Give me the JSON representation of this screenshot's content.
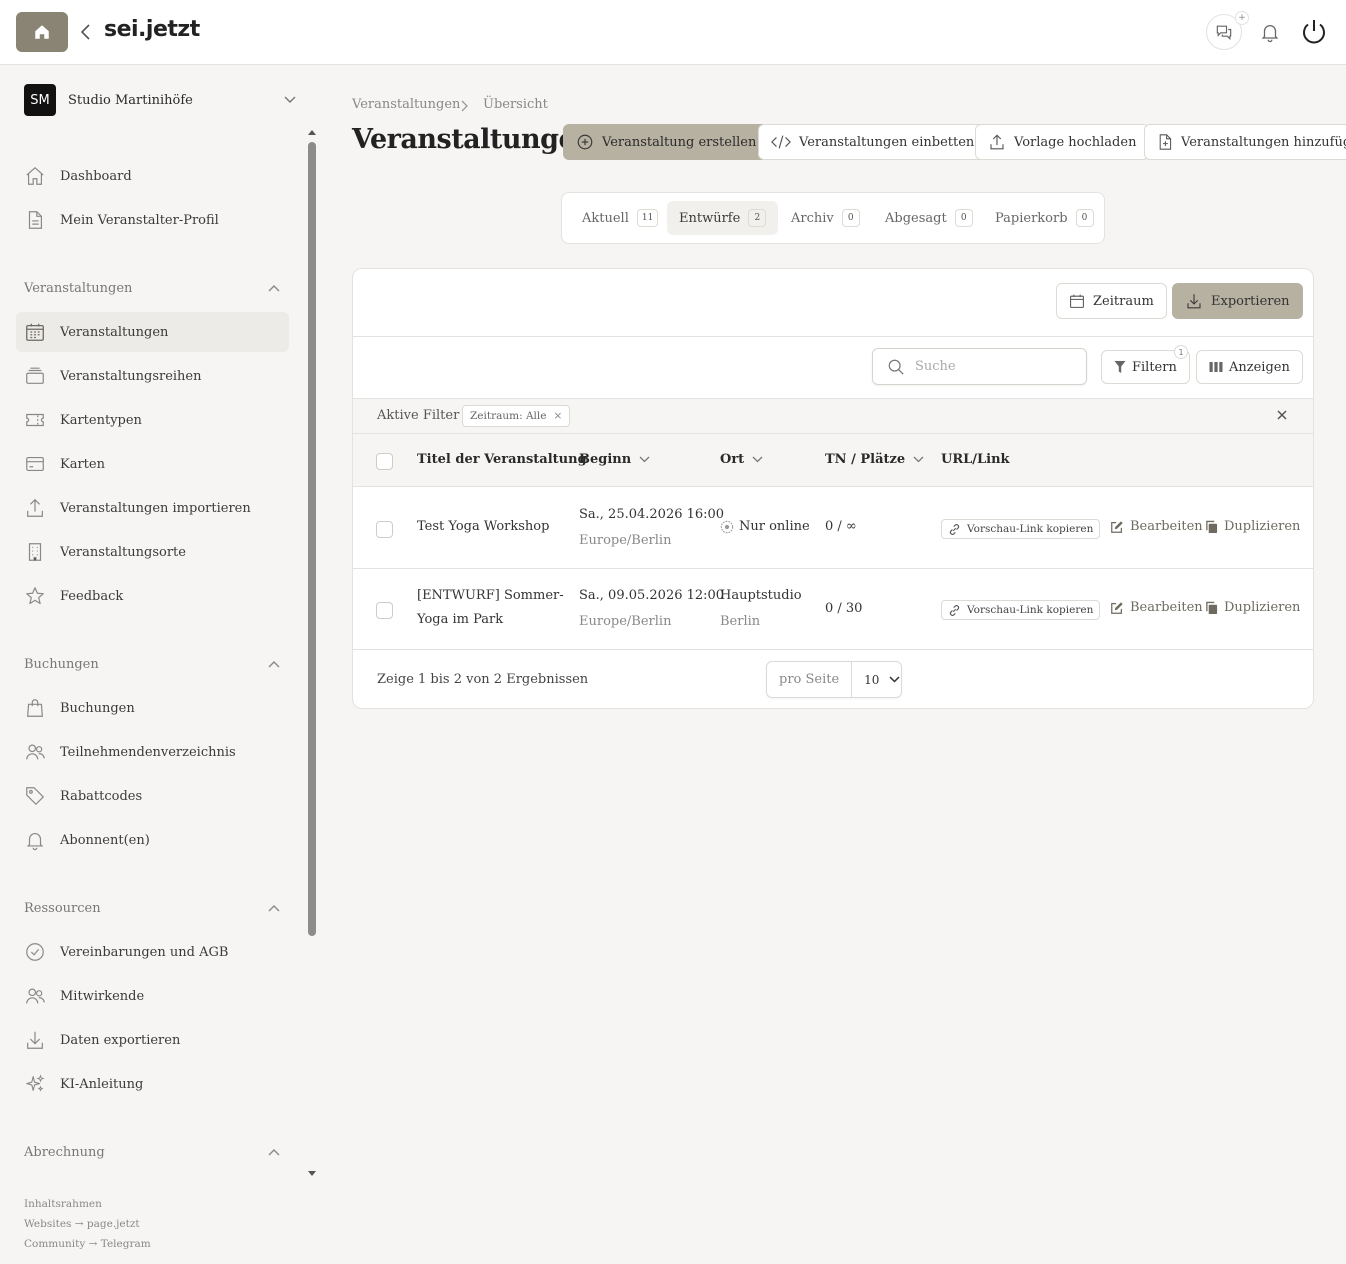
{
  "topbar": {
    "brand": "sei.jetzt",
    "chat_badge": "+"
  },
  "org": {
    "initials": "SM",
    "name": "Studio Martinihöfe"
  },
  "sidebar": {
    "top_items": [
      {
        "label": "Dashboard",
        "icon": "home-icon"
      },
      {
        "label": "Mein Veranstalter-Profil",
        "icon": "document-icon"
      }
    ],
    "sections": [
      {
        "title": "Veranstaltungen",
        "items": [
          {
            "label": "Veranstaltungen",
            "icon": "calendar-icon",
            "active": true
          },
          {
            "label": "Veranstaltungsreihen",
            "icon": "stack-icon"
          },
          {
            "label": "Kartentypen",
            "icon": "ticket-icon"
          },
          {
            "label": "Karten",
            "icon": "card-icon"
          },
          {
            "label": "Veranstaltungen importieren",
            "icon": "upload-icon"
          },
          {
            "label": "Veranstaltungsorte",
            "icon": "building-icon"
          },
          {
            "label": "Feedback",
            "icon": "star-icon"
          }
        ]
      },
      {
        "title": "Buchungen",
        "items": [
          {
            "label": "Buchungen",
            "icon": "bag-icon"
          },
          {
            "label": "Teilnehmendenverzeichnis",
            "icon": "users-icon"
          },
          {
            "label": "Rabattcodes",
            "icon": "tag-icon"
          },
          {
            "label": "Abonnent(en)",
            "icon": "bell-icon"
          }
        ]
      },
      {
        "title": "Ressourcen",
        "items": [
          {
            "label": "Vereinbarungen und AGB",
            "icon": "check-circle-icon"
          },
          {
            "label": "Mitwirkende",
            "icon": "users-icon"
          },
          {
            "label": "Daten exportieren",
            "icon": "download-icon"
          },
          {
            "label": "KI-Anleitung",
            "icon": "sparkle-icon"
          }
        ]
      },
      {
        "title": "Abrechnung",
        "items": []
      }
    ],
    "footer_links": [
      "Inhaltsrahmen",
      "Websites → page.jetzt",
      "Community → Telegram"
    ]
  },
  "breadcrumb": [
    "Veranstaltungen",
    "Übersicht"
  ],
  "page_title": "Veranstaltungen",
  "header_buttons": {
    "create": "Veranstaltung erstellen",
    "embed": "Veranstaltungen einbetten",
    "upload": "Vorlage hochladen",
    "add": "Veranstaltungen hinzufügen"
  },
  "tabs": [
    {
      "label": "Aktuell",
      "count": "11"
    },
    {
      "label": "Entwürfe",
      "count": "2",
      "active": true
    },
    {
      "label": "Archiv",
      "count": "0"
    },
    {
      "label": "Abgesagt",
      "count": "0"
    },
    {
      "label": "Papierkorb",
      "count": "0"
    }
  ],
  "toolbar": {
    "period": "Zeitraum",
    "export": "Exportieren",
    "search_placeholder": "Suche",
    "filter": "Filtern",
    "filter_count": "1",
    "display": "Anzeigen"
  },
  "active_filters": {
    "label": "Aktive Filter",
    "chip": "Zeitraum: Alle"
  },
  "table": {
    "columns": [
      "Titel der Veranstaltung",
      "Beginn",
      "Ort",
      "TN / Plätze",
      "URL/Link"
    ],
    "rows": [
      {
        "title_lines": [
          "Test Yoga Workshop"
        ],
        "start": "Sa., 25.04.2026 16:00",
        "tz": "Europe/Berlin",
        "place": "Nur online",
        "place_sub": "",
        "capacity": "0 / ∞",
        "link": "Vorschau-Link kopieren",
        "edit": "Bearbeiten",
        "duplicate": "Duplizieren"
      },
      {
        "title_lines": [
          "[ENTWURF] Sommer-",
          "Yoga im Park"
        ],
        "start": "Sa., 09.05.2026 12:00",
        "tz": "Europe/Berlin",
        "place": "Hauptstudio",
        "place_sub": "Berlin",
        "capacity": "0 / 30",
        "link": "Vorschau-Link kopieren",
        "edit": "Bearbeiten",
        "duplicate": "Duplizieren"
      }
    ]
  },
  "pagination": {
    "summary": "Zeige 1 bis 2 von 2 Ergebnissen",
    "per_page_label": "pro Seite",
    "per_page_value": "10"
  },
  "colors": {
    "accent": "#8a8474",
    "accent_light": "#b7b1a2",
    "background": "#f6f5f3"
  }
}
